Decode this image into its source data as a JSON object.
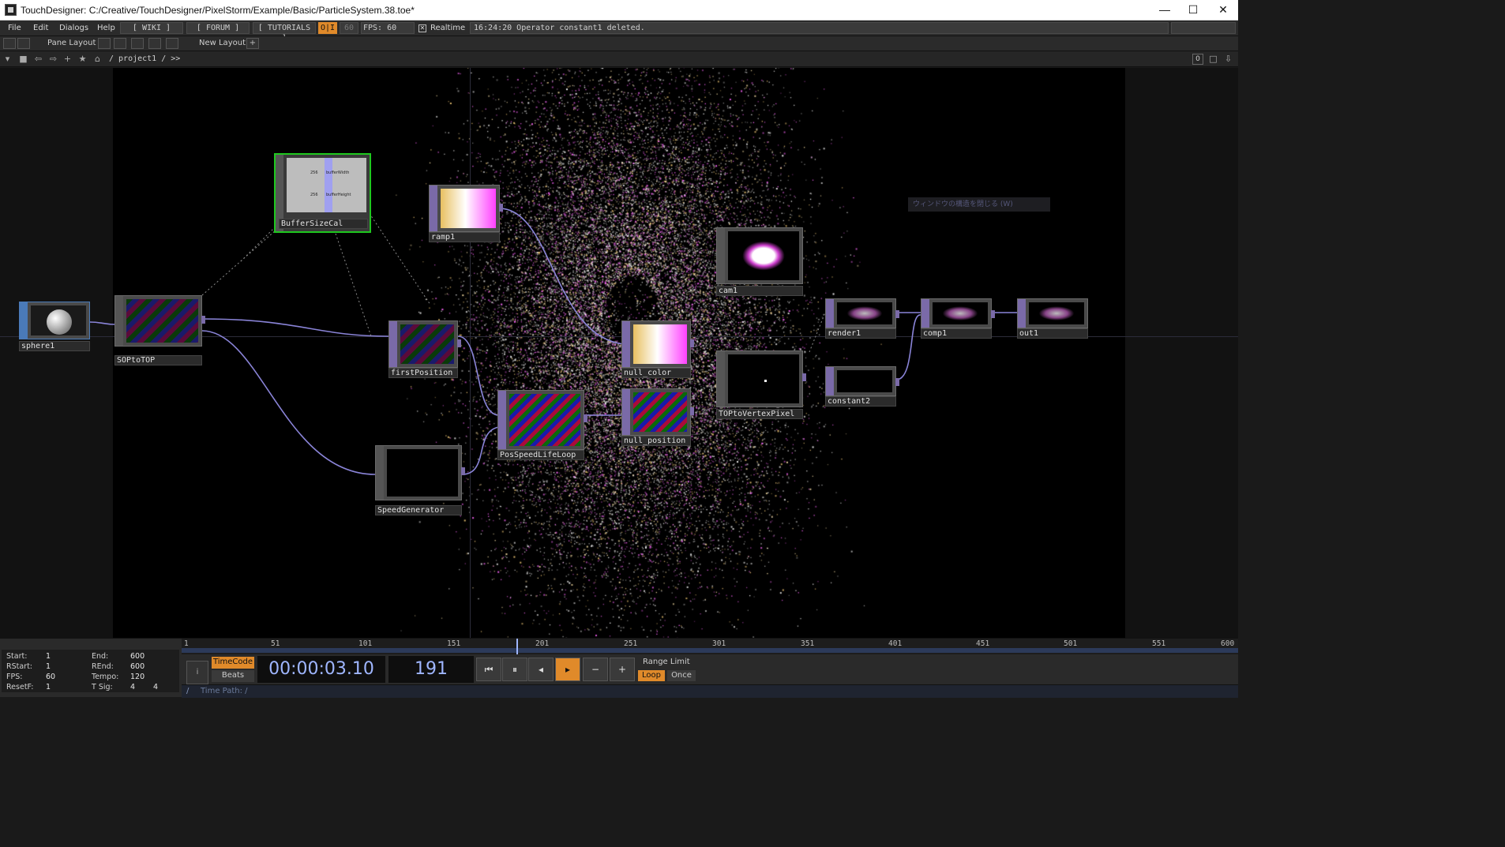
{
  "window": {
    "title": "TouchDesigner: C:/Creative/TouchDesigner/PixelStorm/Example/Basic/ParticleSystem.38.toe*",
    "minimize": "—",
    "maximize": "☐",
    "close": "✕"
  },
  "menubar": {
    "items": [
      "File",
      "Edit",
      "Dialogs",
      "Help"
    ],
    "wiki": "[ WIKI ]",
    "forum": "[ FORUM ]",
    "tutorials": "[ TUTORIALS ]",
    "oi": "O|I",
    "fps_cook": "60",
    "fps_label": "FPS:",
    "fps_value": "60",
    "realtime_label": "Realtime",
    "status_message": "16:24:20 Operator constant1 deleted."
  },
  "panebar": {
    "pane_layout": "Pane Layout",
    "new_layout": "New Layout"
  },
  "pathbar": {
    "path": "/ project1 / >>",
    "counter": "0"
  },
  "network": {
    "tooltip": "ウィンドウの構造を閉じる (W)",
    "nodes": [
      {
        "id": "sphere1",
        "label": "sphere1"
      },
      {
        "id": "soptotop",
        "label": "SOPtoTOP"
      },
      {
        "id": "buffersizecal",
        "label": "BufferSizeCal"
      },
      {
        "id": "ramp1",
        "label": "ramp1"
      },
      {
        "id": "firstposition",
        "label": "firstPosition"
      },
      {
        "id": "speedgenerator",
        "label": "SpeedGenerator"
      },
      {
        "id": "posspeedlifeloop",
        "label": "PosSpeedLifeLoop"
      },
      {
        "id": "null_color",
        "label": "null_color"
      },
      {
        "id": "null_position",
        "label": "null_position"
      },
      {
        "id": "cam1",
        "label": "cam1"
      },
      {
        "id": "toptovertex",
        "label": "TOPtoVertexPixel"
      },
      {
        "id": "render1",
        "label": "render1"
      },
      {
        "id": "constant2",
        "label": "constant2"
      },
      {
        "id": "comp1",
        "label": "comp1"
      },
      {
        "id": "out1",
        "label": "out1"
      }
    ],
    "buffer_rows": [
      "256",
      "256"
    ],
    "buffer_labels": [
      "bufferWidth",
      "bufferHeight"
    ]
  },
  "timeline": {
    "ruler": [
      "1",
      "51",
      "101",
      "151",
      "201",
      "251",
      "301",
      "351",
      "401",
      "451",
      "501",
      "551",
      "600"
    ],
    "stats": {
      "start_label": "Start:",
      "start": "1",
      "rstart_label": "RStart:",
      "rstart": "1",
      "fps_label": "FPS:",
      "fps": "60",
      "resetf_label": "ResetF:",
      "resetf": "1",
      "end_label": "End:",
      "end": "600",
      "rend_label": "REnd:",
      "rend": "600",
      "tempo_label": "Tempo:",
      "tempo": "120",
      "tsig_label": "T Sig:",
      "tsig1": "4",
      "tsig2": "4"
    },
    "timecode_label": "TimeCode",
    "beats_label": "Beats",
    "timecode": "00:00:03.10",
    "frame": "191",
    "range_limit": "Range Limit",
    "loop": "Loop",
    "once": "Once",
    "time_path": "Time Path: /",
    "slash": "/"
  },
  "colors": {
    "accent_orange": "#e08a2a",
    "node_purple": "#7a6aa8",
    "node_blue": "#4a7ab8",
    "selected_green": "#1fc81f",
    "wire": "#8a84d8"
  }
}
